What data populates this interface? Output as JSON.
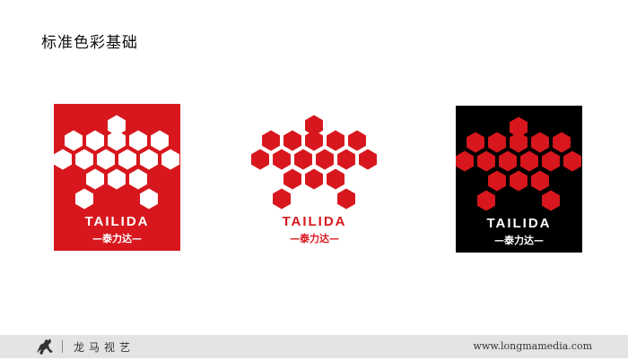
{
  "page": {
    "title": "标准色彩基础"
  },
  "logos": [
    {
      "variant": "red-background",
      "background": "#d7171d",
      "hex_color": "#ffffff",
      "text_color": "#ffffff",
      "wordmark": "TAILIDA",
      "subtitle": "—泰力达—"
    },
    {
      "variant": "white-background",
      "background": "#ffffff",
      "hex_color": "#d7171d",
      "text_color": "#d7171d",
      "wordmark": "TAILIDA",
      "subtitle": "—泰力达—"
    },
    {
      "variant": "black-background",
      "background": "#000000",
      "hex_color": "#d7171d",
      "text_color": "#ffffff",
      "wordmark": "TAILIDA",
      "subtitle": "—泰力达—"
    }
  ],
  "footer": {
    "brand_name": "龙马视艺",
    "url": "www.longmamedia.com",
    "icon": "horse-logo-icon"
  }
}
